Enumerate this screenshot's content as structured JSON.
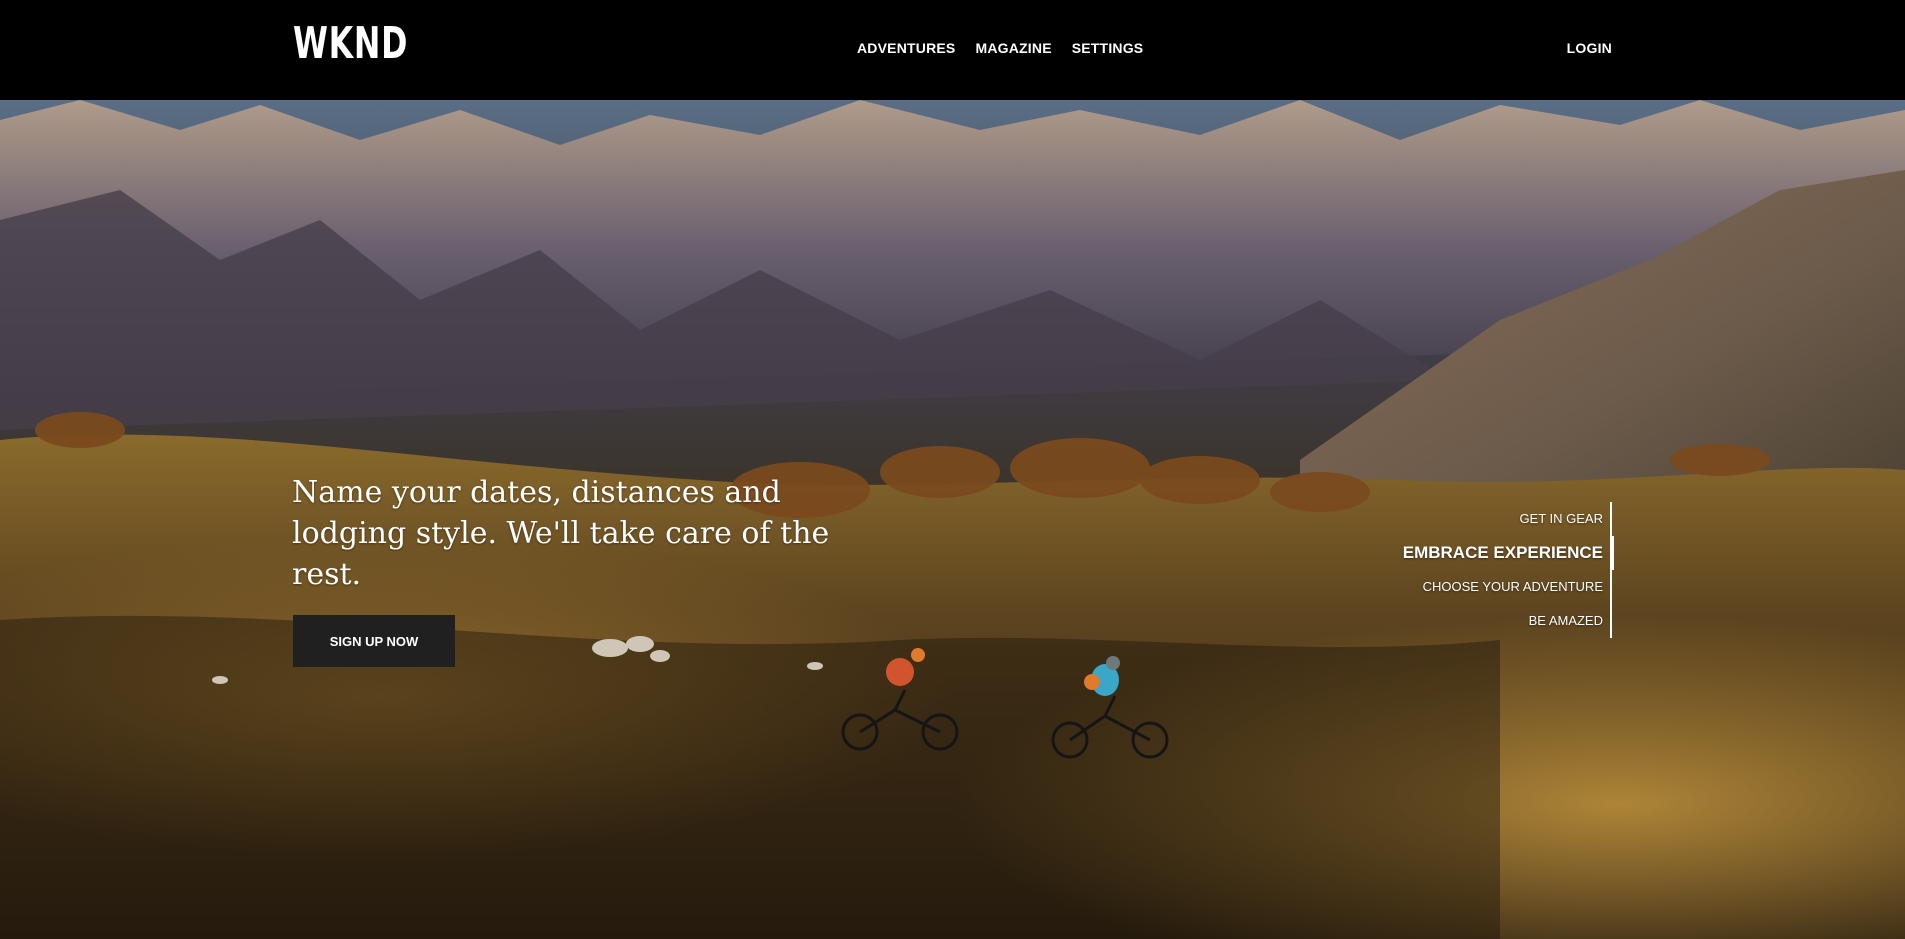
{
  "header": {
    "logo": "WKND",
    "nav": [
      {
        "label": "ADVENTURES"
      },
      {
        "label": "MAGAZINE"
      },
      {
        "label": "SETTINGS"
      }
    ],
    "login_label": "LOGIN"
  },
  "hero": {
    "headline": "Name your dates, distances and lodging style. We'll take care of the rest.",
    "cta_label": "SIGN UP NOW",
    "steps": [
      {
        "label": "GET IN GEAR"
      },
      {
        "label": "EMBRACE EXPERIENCE"
      },
      {
        "label": "CHOOSE YOUR ADVENTURE"
      },
      {
        "label": "BE AMAZED"
      }
    ],
    "active_step": "EMBRACE EXPERIENCE"
  }
}
